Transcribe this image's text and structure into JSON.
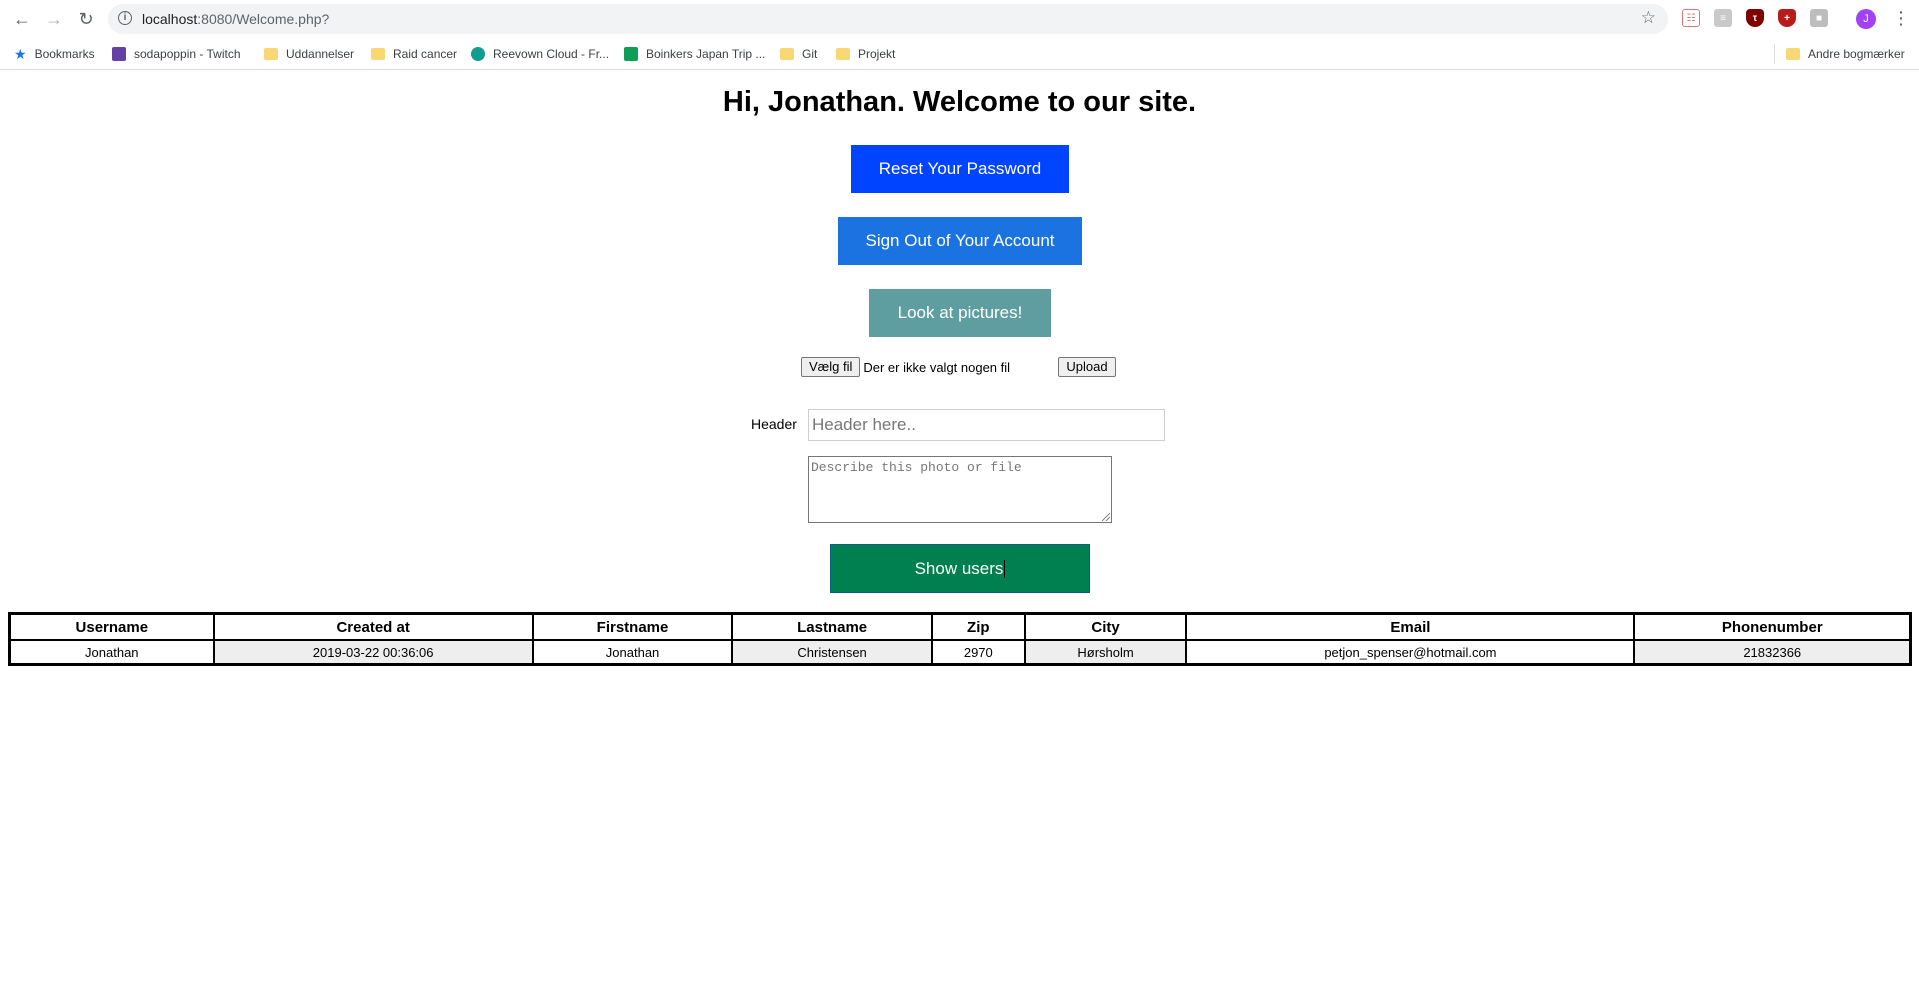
{
  "browser": {
    "url_host": "localhost",
    "url_rest": ":8080/Welcome.php?",
    "profile_initial": "J",
    "bookmarks": [
      {
        "label": "Bookmarks",
        "icon": "star-icon"
      },
      {
        "label": "sodapoppin - Twitch",
        "icon": "twitch-icon"
      },
      {
        "label": "Uddannelser",
        "icon": "folder-icon"
      },
      {
        "label": "Raid cancer",
        "icon": "folder-icon"
      },
      {
        "label": "Reevown Cloud - Fr...",
        "icon": "cloud-icon"
      },
      {
        "label": "Boinkers Japan Trip ...",
        "icon": "sheets-icon"
      },
      {
        "label": "Git",
        "icon": "folder-icon"
      },
      {
        "label": "Projekt",
        "icon": "folder-icon"
      },
      {
        "label": "Andre bogmærker",
        "icon": "folder-icon"
      }
    ]
  },
  "page": {
    "title": "Hi, Jonathan. Welcome to our site.",
    "reset_label": "Reset Your Password",
    "signout_label": "Sign Out of Your Account",
    "pictures_label": "Look at pictures!",
    "choose_file_label": "Vælg fil",
    "no_file_text": "Der er ikke valgt nogen fil",
    "upload_label": "Upload",
    "header_label": "Header",
    "header_placeholder": "Header here..",
    "description_placeholder": "Describe this photo or file",
    "show_users_label": "Show users",
    "colors": {
      "reset": "#0044ff",
      "signout": "#1a73e0",
      "pictures": "#5f9ea0",
      "show_users": "#008050"
    }
  },
  "table": {
    "headers": [
      "Username",
      "Created at",
      "Firstname",
      "Lastname",
      "Zip",
      "City",
      "Email",
      "Phonenumber"
    ],
    "rows": [
      [
        "Jonathan",
        "2019-03-22 00:36:06",
        "Jonathan",
        "Christensen",
        "2970",
        "Hørsholm",
        "petjon_spenser@hotmail.com",
        "21832366"
      ]
    ]
  }
}
